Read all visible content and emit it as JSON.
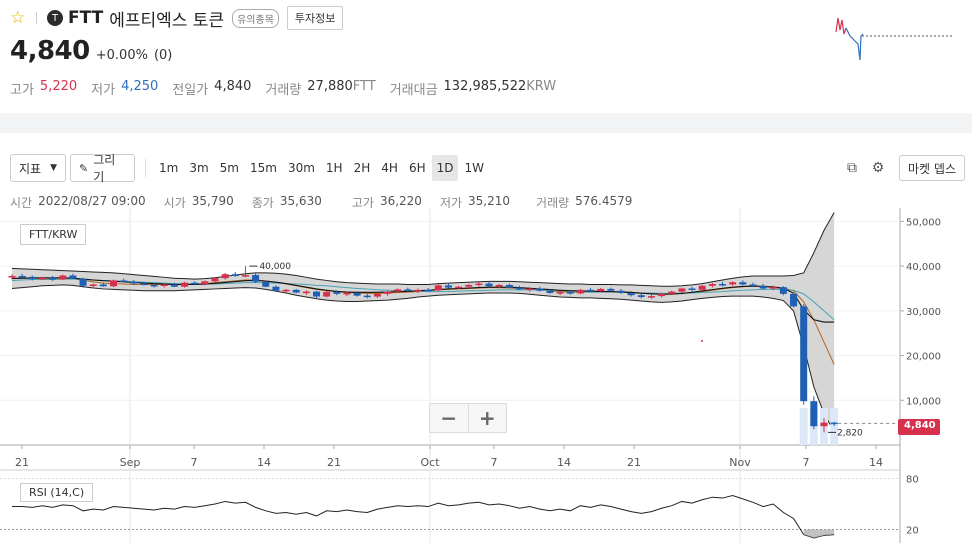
{
  "header": {
    "coin_symbol": "FTT",
    "coin_name": "에프티엑스 토큰",
    "warning_badge": "유의종목",
    "invest_info_label": "투자정보",
    "price": "4,840",
    "change_pct": "+0.00%",
    "change_abs": "(0)",
    "stats": {
      "high_label": "고가",
      "high": "5,220",
      "low_label": "저가",
      "low": "4,250",
      "prev_label": "전일가",
      "prev": "4,840",
      "volume_label": "거래량",
      "volume": "27,880",
      "volume_unit": "FTT",
      "amount_label": "거래대금",
      "amount": "132,985,522",
      "amount_unit": "KRW"
    }
  },
  "toolbar": {
    "indicator_label": "지표",
    "draw_label": "그리기",
    "intervals": [
      "1m",
      "3m",
      "5m",
      "15m",
      "30m",
      "1H",
      "2H",
      "4H",
      "6H",
      "1D",
      "1W"
    ],
    "active_interval": "1D",
    "market_depth_label": "마켓 뎁스"
  },
  "ohlc": {
    "time_label": "시간",
    "time": "2022/08/27 09:00",
    "open_label": "시가",
    "open": "35,790",
    "close_label": "종가",
    "close": "35,630",
    "high_label": "고가",
    "high": "36,220",
    "low_label": "저가",
    "low": "35,210",
    "volume_label": "거래량",
    "volume": "576.4579"
  },
  "chart_data": {
    "type": "candlestick",
    "legend": "FTT/KRW",
    "rsi_label": "RSI (14,C)",
    "x_tick_labels": [
      "21",
      "Sep",
      "7",
      "14",
      "21",
      "Oct",
      "7",
      "14",
      "21",
      "Nov",
      "7",
      "14"
    ],
    "y_tick_labels": [
      "50,000",
      "40,000",
      "30,000",
      "20,000",
      "10,000"
    ],
    "rsi_tick_labels": [
      "80",
      "20"
    ],
    "ylim": [
      0,
      53000
    ],
    "max_annotation": "40,000",
    "min_annotation": "2,820",
    "last_price_label": "4,840",
    "last_price": 4840,
    "candles": [
      [
        37500,
        38200,
        37000,
        37800
      ],
      [
        37800,
        38300,
        37300,
        37600
      ],
      [
        37600,
        37900,
        36800,
        37100
      ],
      [
        37100,
        37600,
        36900,
        37400
      ],
      [
        37400,
        37800,
        36700,
        37000
      ],
      [
        37000,
        38100,
        36900,
        37900
      ],
      [
        37900,
        38300,
        37100,
        37200
      ],
      [
        37200,
        37400,
        35200,
        35600
      ],
      [
        35600,
        36100,
        35000,
        35900
      ],
      [
        35900,
        36300,
        35400,
        35500
      ],
      [
        35500,
        37000,
        35300,
        36800
      ],
      [
        36800,
        37200,
        36300,
        36500
      ],
      [
        36500,
        36900,
        35900,
        36100
      ],
      [
        36100,
        36500,
        35700,
        35800
      ],
      [
        35790,
        36220,
        35210,
        35630
      ],
      [
        35630,
        36100,
        35200,
        35900
      ],
      [
        35900,
        36300,
        35300,
        35400
      ],
      [
        35400,
        36500,
        35200,
        36300
      ],
      [
        36300,
        36600,
        35800,
        36000
      ],
      [
        36000,
        36800,
        35700,
        36600
      ],
      [
        36600,
        37500,
        36300,
        37300
      ],
      [
        37300,
        38500,
        37000,
        38200
      ],
      [
        38200,
        38700,
        37600,
        37800
      ],
      [
        37800,
        40000,
        37500,
        38000
      ],
      [
        38000,
        38300,
        36200,
        36500
      ],
      [
        36500,
        36800,
        35300,
        35400
      ],
      [
        35400,
        35700,
        34300,
        34500
      ],
      [
        34500,
        34900,
        34000,
        34700
      ],
      [
        34700,
        34900,
        33900,
        34100
      ],
      [
        34100,
        34600,
        33600,
        34300
      ],
      [
        34300,
        34500,
        32900,
        33200
      ],
      [
        33200,
        34500,
        33000,
        34200
      ],
      [
        34200,
        34600,
        33500,
        33800
      ],
      [
        33800,
        34400,
        33300,
        34000
      ],
      [
        34000,
        34400,
        33200,
        33400
      ],
      [
        33400,
        33800,
        32800,
        33200
      ],
      [
        33200,
        34000,
        32900,
        33800
      ],
      [
        33800,
        34500,
        33400,
        34300
      ],
      [
        34300,
        35000,
        34000,
        34800
      ],
      [
        34800,
        35200,
        34200,
        34500
      ],
      [
        34500,
        35000,
        34000,
        34700
      ],
      [
        34700,
        35100,
        34300,
        34600
      ],
      [
        34600,
        36000,
        34400,
        35700
      ],
      [
        35700,
        36100,
        35000,
        35200
      ],
      [
        35200,
        35600,
        34800,
        35400
      ],
      [
        35400,
        36000,
        35000,
        35800
      ],
      [
        35800,
        36500,
        35400,
        36100
      ],
      [
        36100,
        36600,
        35300,
        35500
      ],
      [
        35500,
        36000,
        35000,
        35800
      ],
      [
        35800,
        36100,
        35000,
        35200
      ],
      [
        35200,
        35600,
        34600,
        34800
      ],
      [
        34800,
        35300,
        34300,
        35000
      ],
      [
        35000,
        35400,
        34300,
        34500
      ],
      [
        34500,
        34900,
        33800,
        34000
      ],
      [
        34000,
        34500,
        33500,
        34200
      ],
      [
        34200,
        34600,
        33600,
        33900
      ],
      [
        33900,
        34900,
        33700,
        34700
      ],
      [
        34700,
        35100,
        34200,
        34400
      ],
      [
        34400,
        35100,
        34100,
        34900
      ],
      [
        34900,
        35200,
        34300,
        34500
      ],
      [
        34500,
        34900,
        33800,
        34000
      ],
      [
        34000,
        34400,
        33200,
        33500
      ],
      [
        33500,
        33900,
        32800,
        33100
      ],
      [
        33100,
        33600,
        32700,
        33300
      ],
      [
        33300,
        34000,
        33000,
        33800
      ],
      [
        33800,
        34500,
        33500,
        34300
      ],
      [
        34300,
        35200,
        34000,
        35000
      ],
      [
        35000,
        35400,
        34400,
        34700
      ],
      [
        34700,
        35800,
        34500,
        35600
      ],
      [
        35600,
        36300,
        35200,
        36000
      ],
      [
        36000,
        36500,
        35500,
        35900
      ],
      [
        35900,
        36600,
        35600,
        36400
      ],
      [
        36400,
        36800,
        35700,
        35900
      ],
      [
        35900,
        36300,
        35400,
        35600
      ],
      [
        35600,
        36000,
        34700,
        35000
      ],
      [
        35000,
        35600,
        34600,
        35300
      ],
      [
        35300,
        35500,
        33500,
        33800
      ],
      [
        33800,
        34100,
        30800,
        31000
      ],
      [
        31000,
        31500,
        9000,
        9800
      ],
      [
        9800,
        10900,
        3500,
        4200
      ],
      [
        4200,
        6000,
        2820,
        5000
      ],
      [
        5000,
        5220,
        4250,
        4840
      ]
    ],
    "ma": [
      [
        37200,
        36800
      ],
      [
        37300,
        36900
      ],
      [
        37300,
        37000
      ],
      [
        37200,
        37000
      ],
      [
        37200,
        37000
      ],
      [
        37300,
        37100
      ],
      [
        37200,
        37100
      ],
      [
        36800,
        37000
      ],
      [
        36500,
        36900
      ],
      [
        36200,
        36800
      ],
      [
        36100,
        36700
      ],
      [
        36000,
        36600
      ],
      [
        35900,
        36500
      ],
      [
        35900,
        36400
      ],
      [
        35900,
        36300
      ],
      [
        35900,
        36200
      ],
      [
        35900,
        36100
      ],
      [
        35900,
        36000
      ],
      [
        36000,
        36000
      ],
      [
        36100,
        36000
      ],
      [
        36300,
        36000
      ],
      [
        36500,
        36100
      ],
      [
        36700,
        36200
      ],
      [
        36900,
        36300
      ],
      [
        36900,
        36300
      ],
      [
        36700,
        36300
      ],
      [
        36400,
        36200
      ],
      [
        36000,
        36100
      ],
      [
        35600,
        36000
      ],
      [
        35200,
        35900
      ],
      [
        34800,
        35700
      ],
      [
        34500,
        35600
      ],
      [
        34300,
        35400
      ],
      [
        34100,
        35200
      ],
      [
        34000,
        35000
      ],
      [
        33900,
        34900
      ],
      [
        33900,
        34700
      ],
      [
        34000,
        34600
      ],
      [
        34100,
        34500
      ],
      [
        34200,
        34400
      ],
      [
        34300,
        34400
      ],
      [
        34500,
        34300
      ],
      [
        34700,
        34300
      ],
      [
        34800,
        34300
      ],
      [
        34900,
        34400
      ],
      [
        35000,
        34500
      ],
      [
        35100,
        34500
      ],
      [
        35200,
        34600
      ],
      [
        35200,
        34700
      ],
      [
        35100,
        34700
      ],
      [
        35000,
        34700
      ],
      [
        34900,
        34700
      ],
      [
        34700,
        34700
      ],
      [
        34500,
        34600
      ],
      [
        34300,
        34500
      ],
      [
        34200,
        34400
      ],
      [
        34200,
        34300
      ],
      [
        34200,
        34200
      ],
      [
        34300,
        34200
      ],
      [
        34300,
        34200
      ],
      [
        34300,
        34200
      ],
      [
        34200,
        34100
      ],
      [
        34000,
        34000
      ],
      [
        33800,
        34000
      ],
      [
        33700,
        33900
      ],
      [
        33800,
        33900
      ],
      [
        33900,
        34000
      ],
      [
        34100,
        34000
      ],
      [
        34300,
        34100
      ],
      [
        34600,
        34200
      ],
      [
        34900,
        34300
      ],
      [
        35200,
        34500
      ],
      [
        35400,
        34600
      ],
      [
        35500,
        34700
      ],
      [
        35500,
        34800
      ],
      [
        35400,
        34800
      ],
      [
        35100,
        34800
      ],
      [
        34500,
        34600
      ],
      [
        32000,
        33800
      ],
      [
        28000,
        32000
      ],
      [
        23000,
        30000
      ],
      [
        18000,
        28000
      ]
    ],
    "bollinger_upper": [
      39500,
      39400,
      39300,
      39200,
      39100,
      39000,
      38900,
      38800,
      38700,
      38600,
      38500,
      38300,
      38100,
      37900,
      37700,
      37500,
      37300,
      37200,
      37100,
      37200,
      37400,
      37700,
      38000,
      38300,
      38500,
      38500,
      38400,
      38200,
      37900,
      37500,
      37100,
      36800,
      36500,
      36300,
      36200,
      36100,
      36000,
      36000,
      36000,
      35900,
      35900,
      35900,
      36100,
      36200,
      36300,
      36400,
      36500,
      36600,
      36600,
      36600,
      36500,
      36400,
      36300,
      36200,
      36100,
      36000,
      36000,
      35900,
      35900,
      35900,
      35800,
      35800,
      35700,
      35600,
      35500,
      35500,
      35600,
      35800,
      36100,
      36500,
      36900,
      37300,
      37600,
      37800,
      37800,
      37800,
      37800,
      37900,
      38500,
      43000,
      48000,
      52000
    ],
    "bollinger_lower": [
      35000,
      35200,
      35400,
      35600,
      35700,
      35800,
      35700,
      35400,
      35100,
      34900,
      34800,
      34700,
      34600,
      34500,
      34500,
      34500,
      34500,
      34600,
      34700,
      34800,
      34900,
      35000,
      35100,
      35200,
      35100,
      34800,
      34400,
      34000,
      33500,
      33100,
      32700,
      32400,
      32200,
      32100,
      32100,
      32200,
      32300,
      32400,
      32600,
      32800,
      33100,
      33300,
      33500,
      33600,
      33700,
      33800,
      33900,
      34000,
      34000,
      34000,
      33900,
      33700,
      33500,
      33300,
      33100,
      33000,
      32900,
      32900,
      32800,
      32700,
      32600,
      32400,
      32200,
      32000,
      31900,
      32000,
      32200,
      32500,
      32800,
      33000,
      33200,
      33300,
      33300,
      33300,
      33100,
      32800,
      32300,
      30000,
      22000,
      13000,
      7000,
      3000
    ],
    "rsi": [
      47,
      47,
      46,
      48,
      46,
      49,
      48,
      42,
      44,
      43,
      47,
      46,
      45,
      44,
      43,
      45,
      44,
      47,
      46,
      48,
      50,
      53,
      51,
      52,
      46,
      42,
      39,
      40,
      38,
      40,
      36,
      42,
      41,
      43,
      41,
      40,
      44,
      46,
      48,
      47,
      48,
      47,
      51,
      48,
      49,
      51,
      52,
      49,
      50,
      48,
      45,
      47,
      44,
      42,
      44,
      42,
      48,
      46,
      49,
      47,
      44,
      41,
      39,
      41,
      45,
      48,
      53,
      51,
      55,
      58,
      57,
      60,
      56,
      52,
      47,
      50,
      40,
      33,
      14,
      10,
      13,
      14
    ]
  }
}
